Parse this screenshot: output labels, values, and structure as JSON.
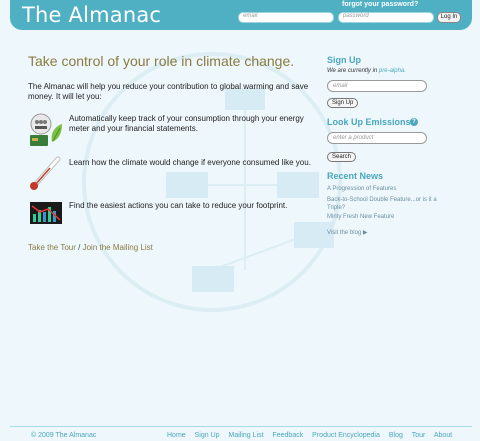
{
  "header": {
    "logo": "The Almanac",
    "forgot_password": "forgot your password?",
    "email_placeholder": "email",
    "password_placeholder": "password",
    "login_label": "Log In"
  },
  "main": {
    "headline": "Take control of your role in climate change.",
    "intro": "The Almanac will help you reduce your contribution to global warming and save money. It will let you:",
    "features": [
      {
        "icon": "meter-and-card-icon",
        "text": "Automatically keep track of your consumption through your energy meter and your financial statements."
      },
      {
        "icon": "thermometer-icon",
        "text": "Learn how the climate would change if everyone consumed like you."
      },
      {
        "icon": "chart-icon",
        "text": "Find the easiest actions you can take to reduce your footprint."
      }
    ],
    "tour_link": "Take the Tour",
    "tour_sep": "/",
    "mailing_link": "Join the Mailing List"
  },
  "sidebar": {
    "signup_heading": "Sign Up",
    "signup_note_prefix": "We are currently in ",
    "signup_note_em": "pre-alpha.",
    "signup_placeholder": "email",
    "signup_button": "Sign Up",
    "lookup_heading": "Look Up Emissions",
    "lookup_placeholder": "enter a product",
    "search_button": "Search",
    "news_heading": "Recent News",
    "news": [
      "A Progression of Features",
      "Back-to-School Double Feature...or is it a Triple?",
      "Minty Fresh New Feature"
    ],
    "visit_blog": "Visit the blog"
  },
  "footer": {
    "copyright": "© 2009 The Almanac",
    "links": [
      "Home",
      "Sign Up",
      "Mailing List",
      "Feedback",
      "Product Encyclopedia",
      "Blog",
      "Tour",
      "About"
    ]
  },
  "colors": {
    "header": "#4fb0c4",
    "accent": "#4aa6bd",
    "headline": "#8a7a40",
    "background": "#eef8fc"
  }
}
